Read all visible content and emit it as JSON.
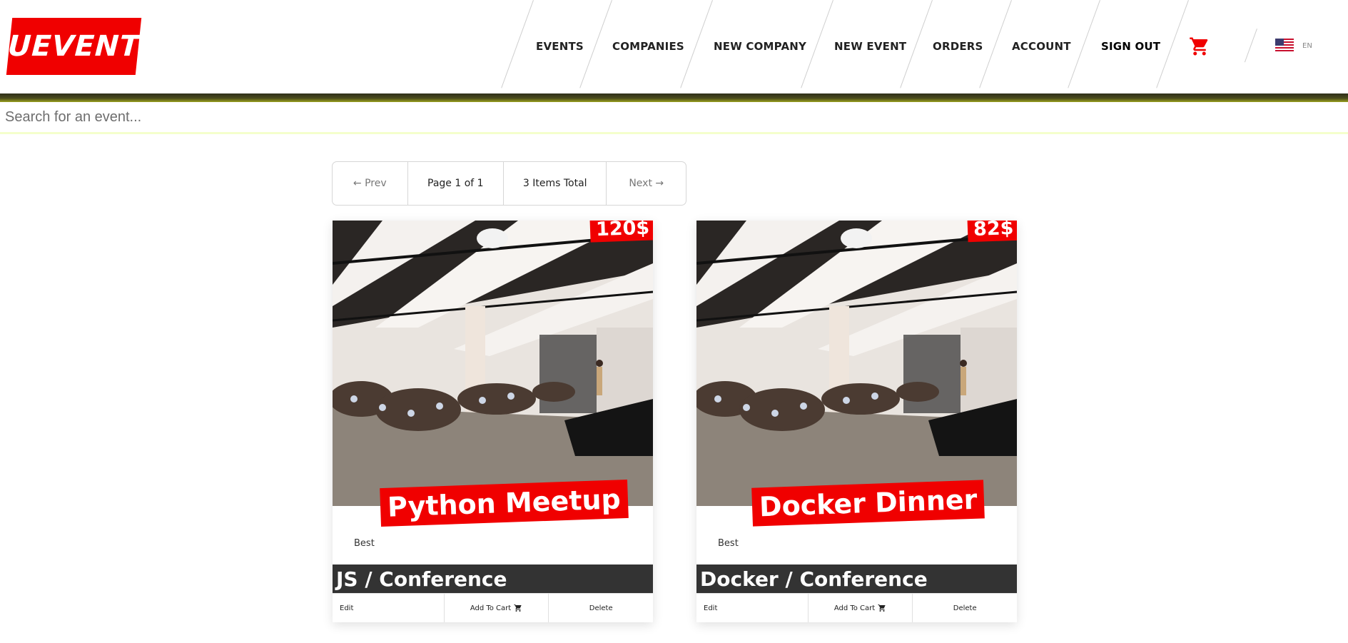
{
  "header": {
    "logo_text": "UEVENT",
    "nav": [
      {
        "label": "EVENTS"
      },
      {
        "label": "COMPANIES"
      },
      {
        "label": "NEW COMPANY"
      },
      {
        "label": "NEW EVENT"
      },
      {
        "label": "ORDERS"
      },
      {
        "label": "ACCOUNT"
      },
      {
        "label": "SIGN OUT"
      }
    ],
    "cart_icon": "cart-icon",
    "language": {
      "flag": "us-flag-icon",
      "label": "EN"
    },
    "colors": {
      "brand": "#f00000",
      "accent_bar": "#4a4a1c"
    }
  },
  "search": {
    "placeholder": "Search for an event...",
    "value": ""
  },
  "pagination": {
    "prev_label": "← Prev",
    "page_label": "Page 1 of 1",
    "total_label": "3 Items Total",
    "next_label": "Next →"
  },
  "events": [
    {
      "price": "120$",
      "title": "Python Meetup",
      "description": "Best",
      "category": "JS / Conference",
      "actions": {
        "edit": "Edit",
        "add_to_cart": "Add To Cart",
        "delete": "Delete"
      }
    },
    {
      "price": "82$",
      "title": "Docker Dinner",
      "description": "Best",
      "category": "Docker / Conference",
      "actions": {
        "edit": "Edit",
        "add_to_cart": "Add To Cart",
        "delete": "Delete"
      }
    }
  ]
}
